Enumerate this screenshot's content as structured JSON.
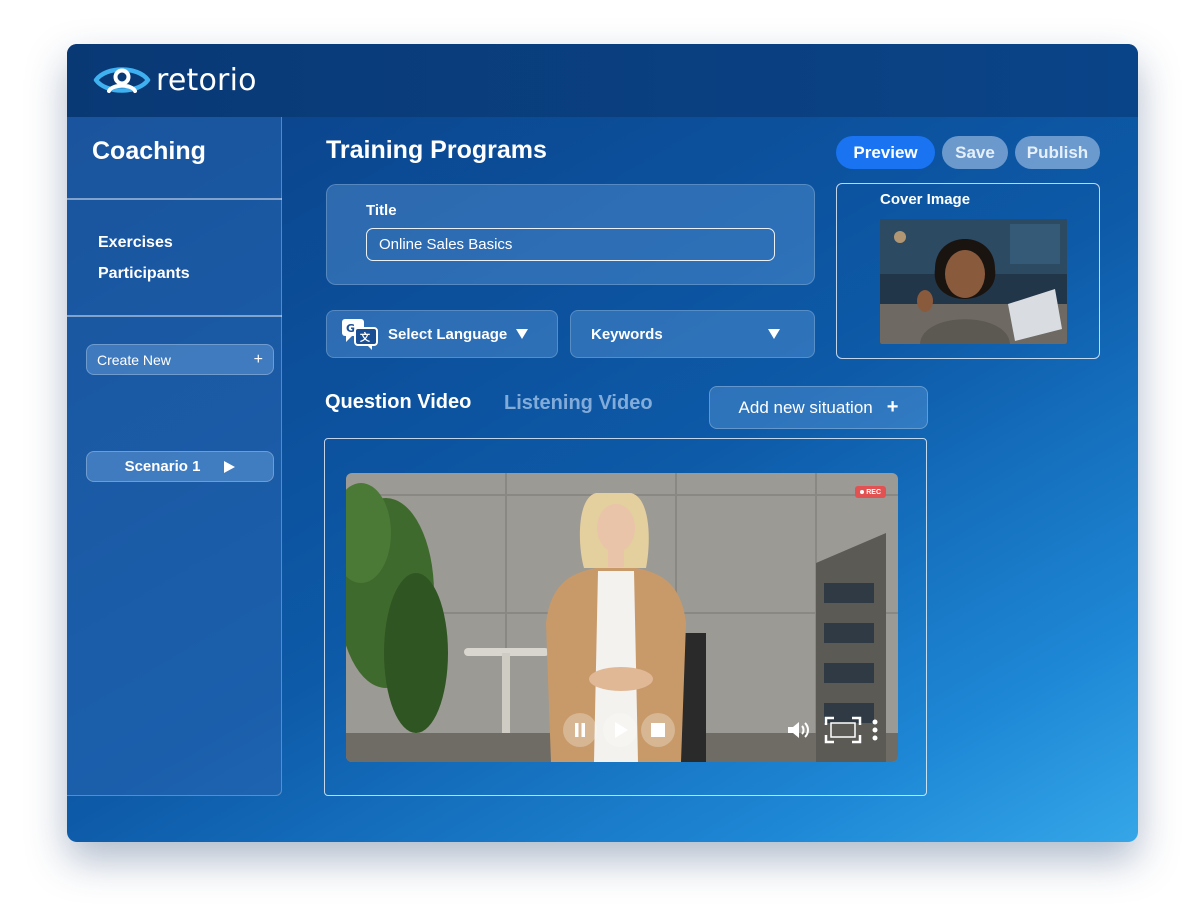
{
  "app": {
    "logo_text": "retorio"
  },
  "sidebar": {
    "title": "Coaching",
    "links": [
      "Exercises",
      "Participants"
    ],
    "create_new": "Create New",
    "scenario": "Scenario 1"
  },
  "main": {
    "title": "Training Programs",
    "buttons": {
      "preview": "Preview",
      "save": "Save",
      "publish": "Publish"
    },
    "title_field": {
      "label": "Title",
      "value": "Online Sales Basics"
    },
    "cover": {
      "label": "Cover Image"
    },
    "language": {
      "label": "Select Language"
    },
    "keywords": {
      "label": "Keywords"
    },
    "tabs": {
      "question": "Question Video",
      "listening": "Listening Video"
    },
    "add_situation": "Add new situation"
  },
  "video": {
    "rec_label": "REC"
  },
  "colors": {
    "accent": "#1a73f0",
    "rec": "#e25252"
  }
}
